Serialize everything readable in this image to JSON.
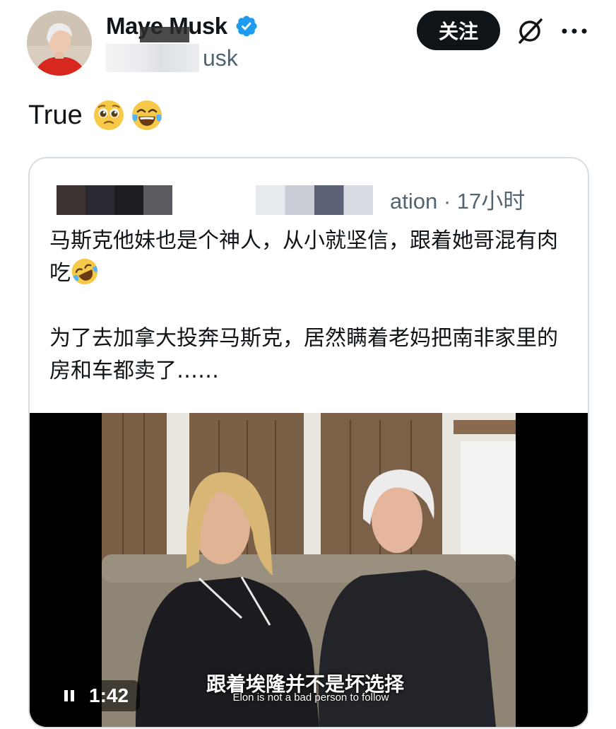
{
  "author": {
    "display_name": "Maye Musk",
    "handle": "@mayemusk",
    "handle_visible": "usk"
  },
  "actions": {
    "follow_label": "关注"
  },
  "tweet": {
    "text": "True"
  },
  "quote": {
    "meta": "ation · 17小时",
    "paragraph_1": "马斯克他妹也是个神人，从小就坚信，跟着她哥混有肉吃",
    "paragraph_2": "为了去加拿大投奔马斯克，居然瞒着老妈把南非家里的房和车都卖了……"
  },
  "video": {
    "time": "1:42",
    "subtitle_zh": "跟着埃隆并不是坏选择",
    "subtitle_en": "Elon is not a bad person to follow"
  },
  "colors": {
    "text_primary": "#0f1419",
    "text_secondary": "#536471",
    "verified_blue": "#1d9bf0",
    "button_black": "#0f1419"
  }
}
